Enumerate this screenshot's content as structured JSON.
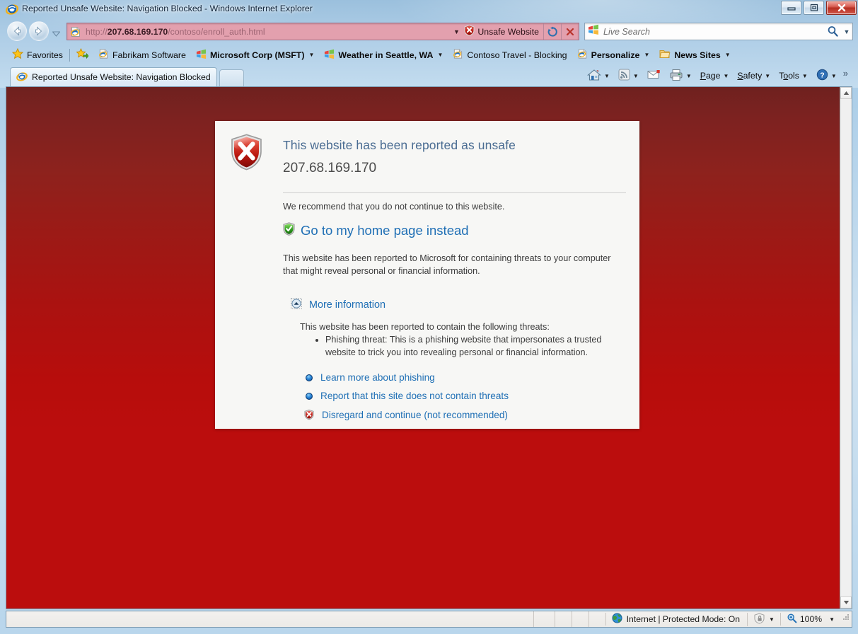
{
  "window": {
    "title": "Reported Unsafe Website: Navigation Blocked - Windows Internet Explorer",
    "minimize_label": "Minimize",
    "maximize_label": "Maximize",
    "close_label": "Close"
  },
  "navigation": {
    "back_label": "Back",
    "forward_label": "Forward",
    "history_label": "Recent Pages",
    "address": {
      "protocol_prefix": "http://",
      "host": "207.68.169.170",
      "path": "/contoso/enroll_auth.html",
      "full": "http://207.68.169.170/contoso/enroll_auth.html",
      "dropdown_label": "Address dropdown",
      "refresh_label": "Refresh",
      "stop_label": "Stop"
    },
    "unsafe_badge": {
      "label": "Unsafe Website",
      "icon": "red-shield-x-icon"
    },
    "search": {
      "placeholder": "Live Search",
      "go_label": "Search",
      "dropdown_label": "Search provider dropdown",
      "icon": "windows-flag-icon"
    }
  },
  "favorites_bar": {
    "favorites_button": "Favorites",
    "add_label": "Add to Favorites Bar",
    "items": [
      {
        "label": "Fabrikam Software",
        "icon": "ie-page-icon",
        "bold": false,
        "caret": false
      },
      {
        "label": "Microsoft Corp (MSFT)",
        "icon": "windows-flag-icon",
        "bold": true,
        "caret": true
      },
      {
        "label": "Weather in Seattle, WA",
        "icon": "windows-flag-icon",
        "bold": true,
        "caret": true
      },
      {
        "label": "Contoso Travel - Blocking",
        "icon": "ie-page-icon",
        "bold": false,
        "caret": false
      },
      {
        "label": "Personalize",
        "icon": "ie-page-icon",
        "bold": true,
        "caret": true
      },
      {
        "label": "News Sites",
        "icon": "folder-icon",
        "bold": true,
        "caret": true
      }
    ]
  },
  "tabs": {
    "active_tab": "Reported Unsafe Website: Navigation Blocked",
    "new_tab_label": "New Tab"
  },
  "command_bar": {
    "home_label": "Home",
    "feeds_label": "Feeds",
    "mail_label": "Read Mail",
    "print_label": "Print",
    "page_label": "Page",
    "safety_label": "Safety",
    "tools_label": "Tools",
    "help_label": "Help",
    "overflow_label": "More"
  },
  "warning_page": {
    "shield_icon": "red-shield-x-icon",
    "title": "This website has been reported as unsafe",
    "url": "207.68.169.170",
    "recommendation": "We recommend that you do not continue to this website.",
    "home_link": {
      "label": "Go to my home page instead",
      "icon": "green-shield-check-icon"
    },
    "description": "This website has been reported to Microsoft for containing threats to your computer that might reveal personal or financial information.",
    "more_information": {
      "label": "More information",
      "icon": "collapse-up-chevron-icon",
      "intro": "This website has been reported to contain the following threats:",
      "threats": [
        "Phishing threat: This is a phishing website that impersonates a trusted website to trick you into revealing personal or financial information."
      ]
    },
    "links": [
      {
        "label": "Learn more about phishing",
        "icon": "blue-dot-icon"
      },
      {
        "label": "Report that this site does not contain threats",
        "icon": "blue-dot-icon"
      },
      {
        "label": "Disregard and continue (not recommended)",
        "icon": "red-shield-x-icon"
      }
    ]
  },
  "status_bar": {
    "message": "",
    "zone": "Internet | Protected Mode: On",
    "zone_icon": "globe-icon",
    "protected_mode_icon": "lock-shield-icon",
    "zoom_icon": "magnifier-plus-icon",
    "zoom_level": "100%"
  },
  "colors": {
    "page_bg_top": "#6f211f",
    "page_bg_bottom": "#bb0d0d",
    "card_bg": "#f7f7f5",
    "link_blue": "#1f6fb5",
    "heading_blue": "#4a6c92",
    "address_bar_red": "#e3a0ae",
    "close_button_red": "#b62f22"
  }
}
